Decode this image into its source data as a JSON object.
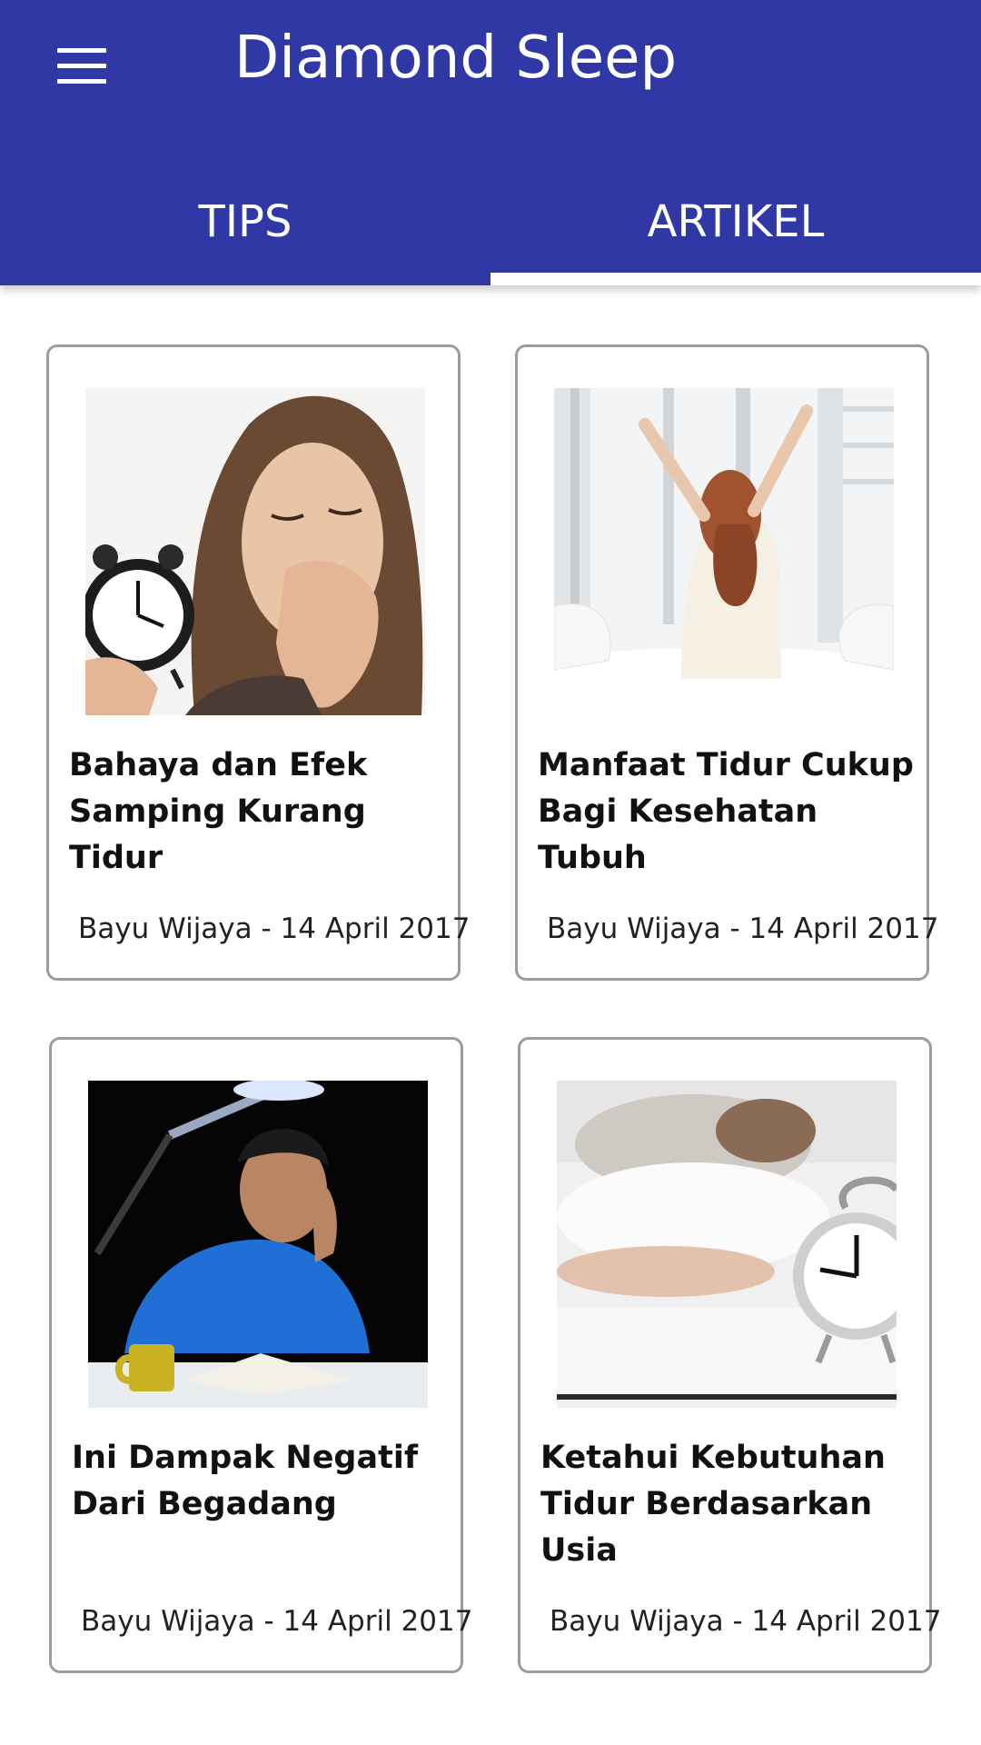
{
  "app": {
    "title": "Diamond Sleep"
  },
  "tabs": [
    {
      "label": "TIPS",
      "selected": false
    },
    {
      "label": "ARTIKEL",
      "selected": true
    }
  ],
  "colors": {
    "primary": "#2f38a4",
    "indicator": "#ffffff",
    "card_border": "#9c9c9c"
  },
  "articles": [
    {
      "title": "Bahaya dan Efek Samping Kurang Tidur",
      "meta": "Bayu Wijaya - 14 April 2017",
      "image": "yawning-woman-alarm-clock"
    },
    {
      "title": "Manfaat Tidur Cukup Bagi Kesehatan Tubuh",
      "meta": "Bayu Wijaya - 14 April 2017",
      "image": "woman-stretching-morning"
    },
    {
      "title": "Ini Dampak Negatif Dari Begadang",
      "meta": "Bayu Wijaya - 14 April 2017",
      "image": "tired-man-studying-night"
    },
    {
      "title": "Ketahui Kebutuhan Tidur Berdasarkan Usia",
      "meta": "Bayu Wijaya - 14 April 2017",
      "image": "sleeping-person-alarm-clock"
    }
  ]
}
